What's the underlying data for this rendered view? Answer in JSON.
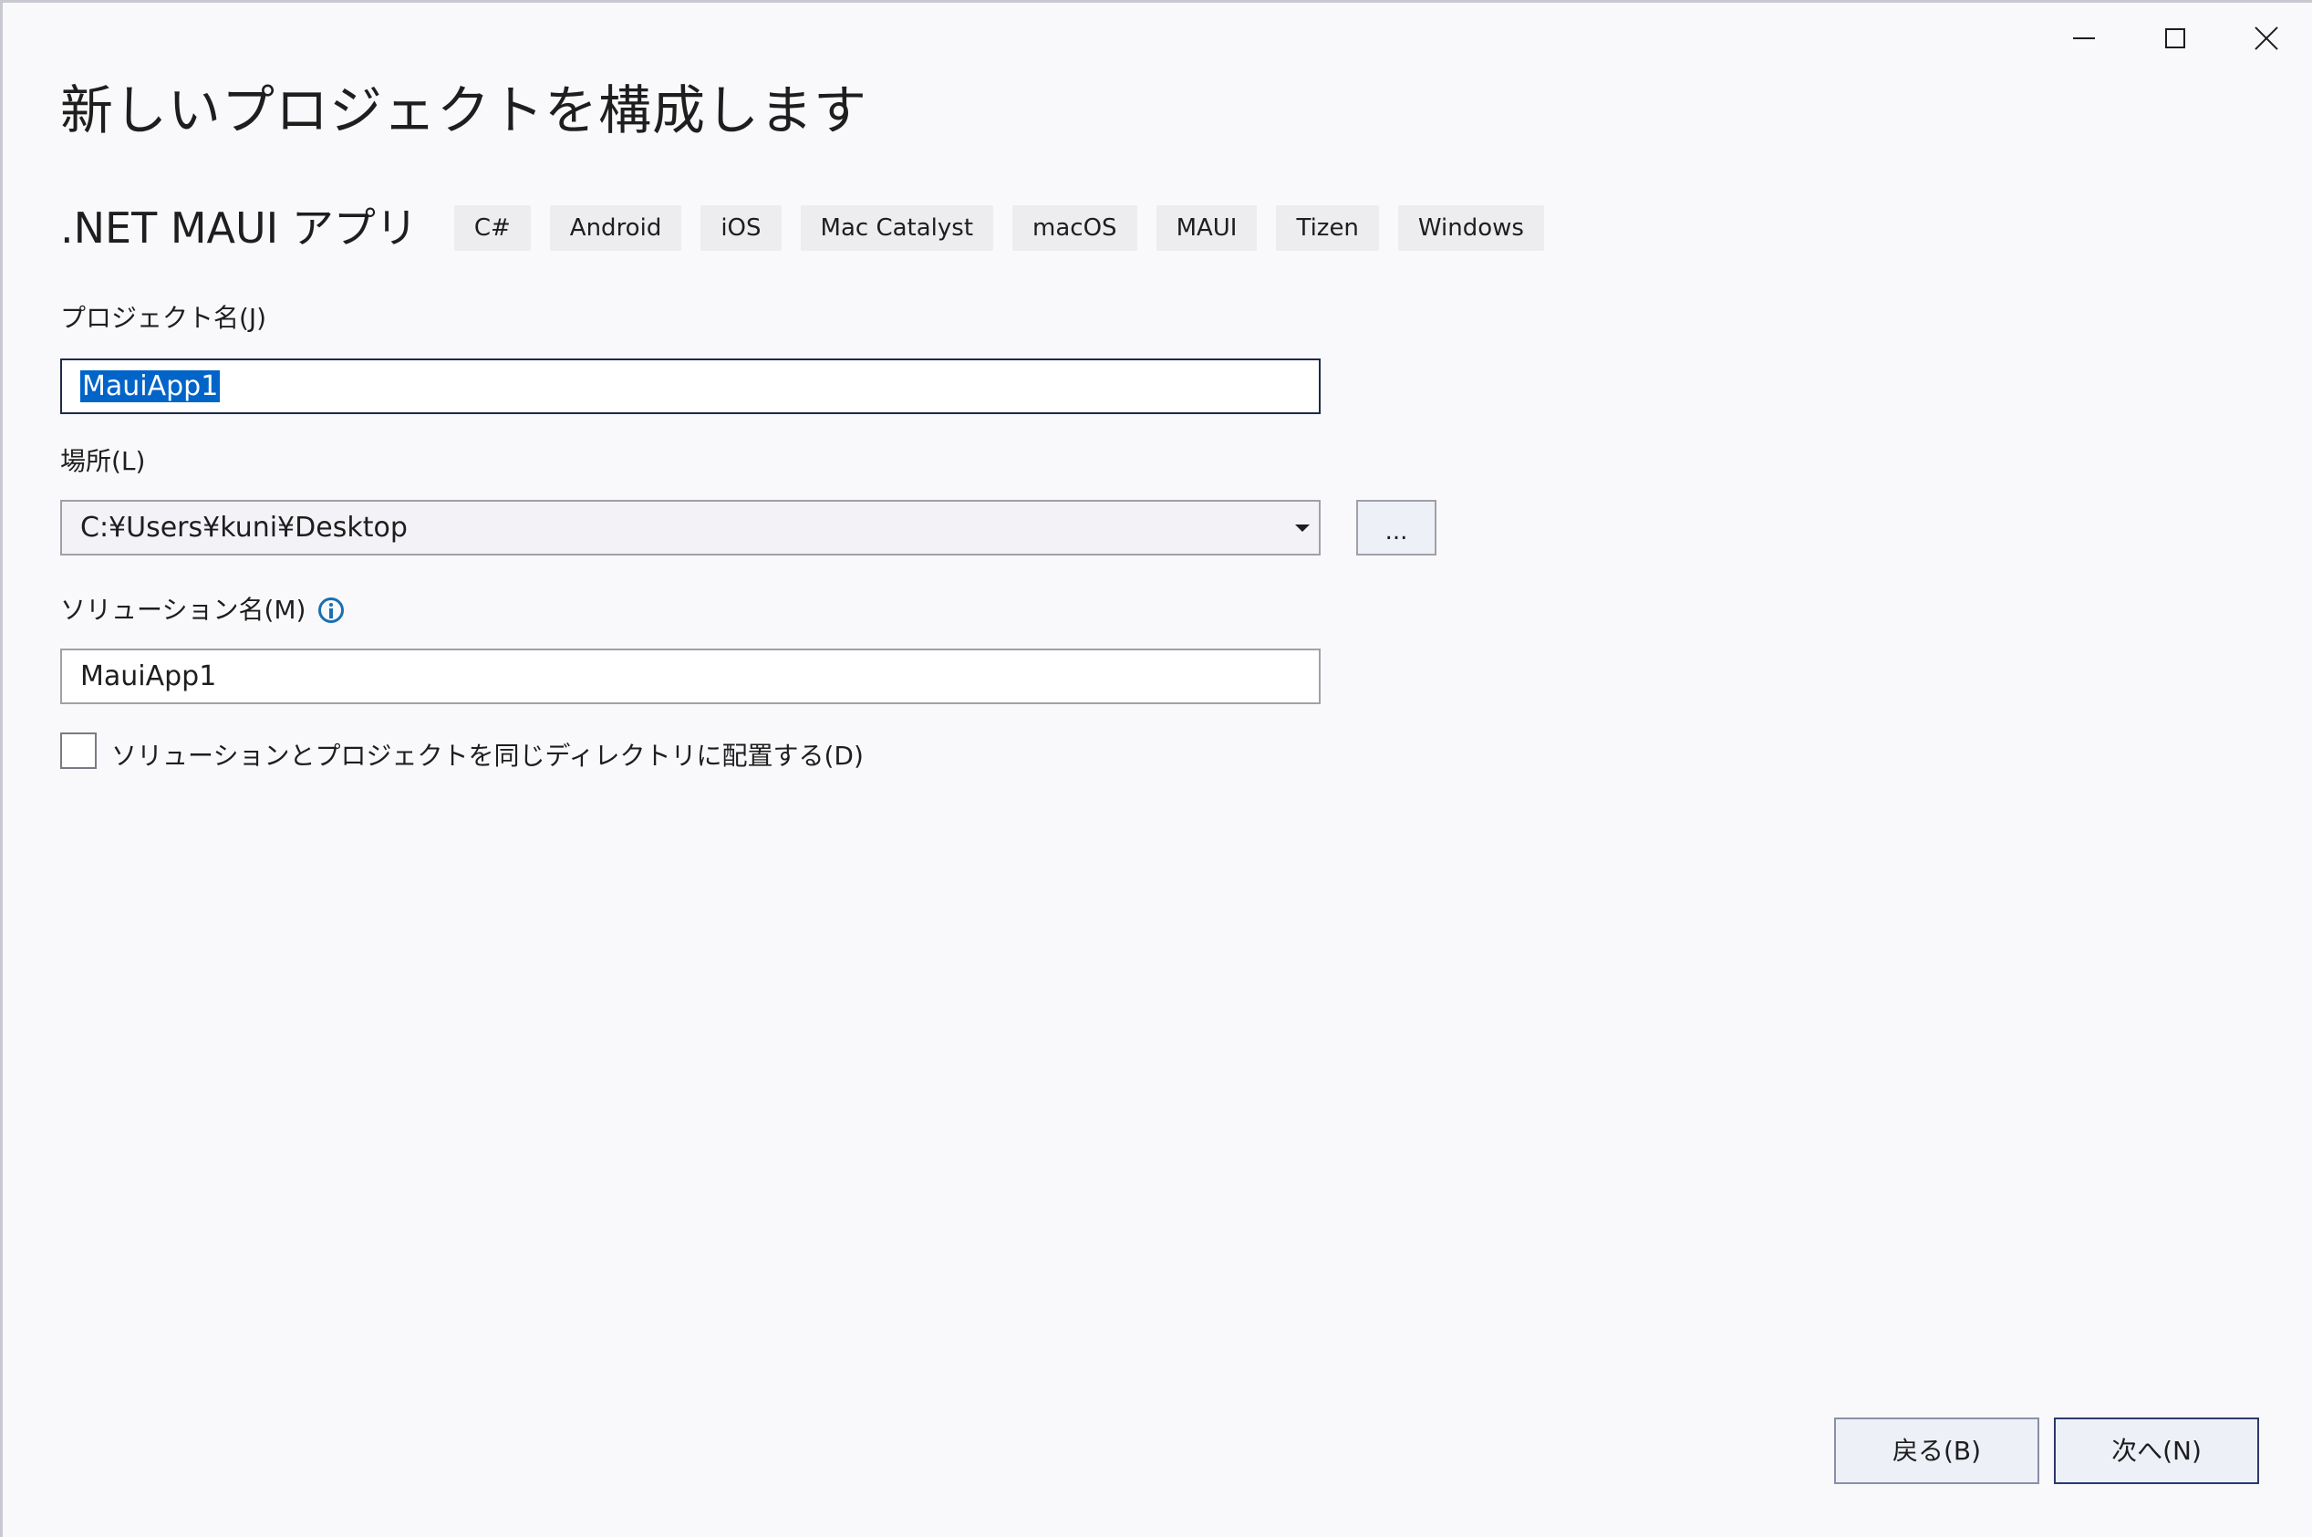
{
  "window": {
    "minimize_icon": "minimize-icon",
    "maximize_icon": "maximize-icon",
    "close_icon": "close-icon"
  },
  "page_title": "新しいプロジェクトを構成します",
  "template": {
    "name": ".NET MAUI アプリ",
    "tags": [
      "C#",
      "Android",
      "iOS",
      "Mac Catalyst",
      "macOS",
      "MAUI",
      "Tizen",
      "Windows"
    ]
  },
  "form": {
    "project_name": {
      "label": "プロジェクト名(J)",
      "value": "MauiApp1"
    },
    "location": {
      "label": "場所(L)",
      "value": "C:¥Users¥kuni¥Desktop",
      "browse_label": "..."
    },
    "solution_name": {
      "label": "ソリューション名(M)",
      "value": "MauiApp1",
      "info_icon": "info-icon"
    },
    "same_directory": {
      "label": "ソリューションとプロジェクトを同じディレクトリに配置する(D)",
      "checked": false
    }
  },
  "footer": {
    "back_label": "戻る(B)",
    "next_label": "次へ(N)"
  },
  "colors": {
    "background": "#f9f9fb",
    "selection": "#0064c8",
    "info": "#1a6fb0",
    "tag_bg": "#ededf0"
  }
}
